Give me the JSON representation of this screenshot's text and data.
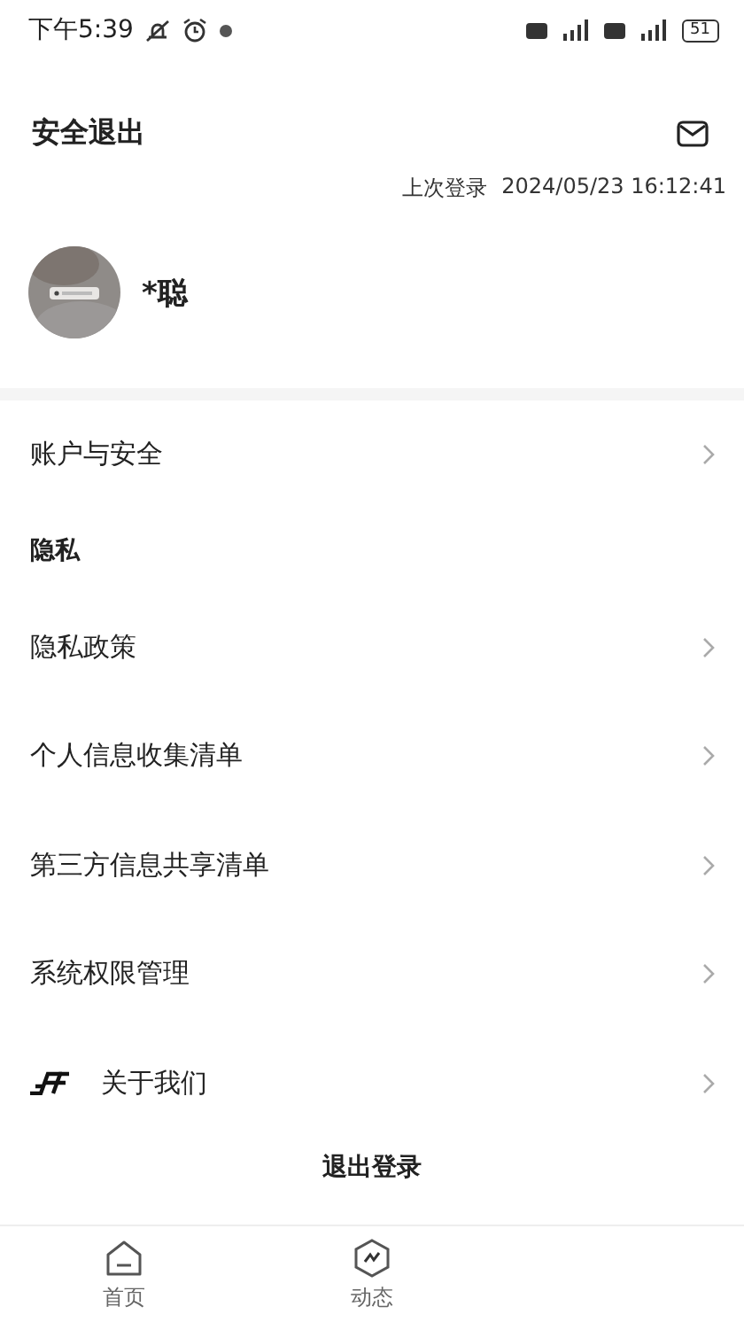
{
  "status_bar": {
    "time": "下午5:39",
    "battery": "51"
  },
  "header": {
    "title": "安全退出"
  },
  "last_login": {
    "label": "上次登录",
    "value": "2024/05/23 16:12:41"
  },
  "profile": {
    "name": "*聪"
  },
  "menu": [
    {
      "kind": "link",
      "label": "账户与安全"
    },
    {
      "kind": "header",
      "label": "隐私"
    },
    {
      "kind": "link",
      "label": "隐私政策"
    },
    {
      "kind": "link",
      "label": "个人信息收集清单"
    },
    {
      "kind": "link",
      "label": "第三方信息共享清单"
    },
    {
      "kind": "link",
      "label": "系统权限管理"
    },
    {
      "kind": "logo-link",
      "label": "关于我们"
    }
  ],
  "logout": "退出登录",
  "tabs": [
    {
      "label": "首页",
      "selected": false
    },
    {
      "label": "动态",
      "selected": false
    }
  ]
}
